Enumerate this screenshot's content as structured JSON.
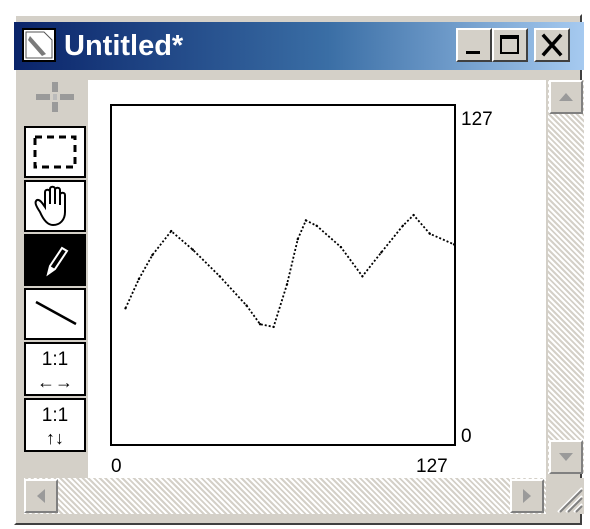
{
  "window": {
    "title": "Untitled*",
    "buttons": {
      "minimize": "minimize",
      "maximize": "maximize",
      "close": "close"
    }
  },
  "toolbar": {
    "tools": [
      {
        "name": "move",
        "icon": "move-cross-icon"
      },
      {
        "name": "marquee-select",
        "icon": "dashed-rectangle-icon"
      },
      {
        "name": "hand",
        "icon": "hand-icon"
      },
      {
        "name": "pencil",
        "icon": "pencil-icon",
        "selected": true
      },
      {
        "name": "line",
        "icon": "line-icon"
      }
    ],
    "zoom_horizontal": {
      "ratio": "1:1",
      "arrows": "←→"
    },
    "zoom_vertical": {
      "ratio": "1:1",
      "arrows": "↑↓"
    }
  },
  "graph": {
    "y_max_label": "127",
    "y_min_label": "0",
    "x_min_label": "0",
    "x_max_label": "127"
  },
  "chart_data": {
    "type": "line",
    "xlim": [
      0,
      127
    ],
    "ylim": [
      0,
      127
    ],
    "points": [
      [
        5,
        51
      ],
      [
        10,
        62
      ],
      [
        15,
        71
      ],
      [
        22,
        80
      ],
      [
        30,
        73
      ],
      [
        40,
        63
      ],
      [
        50,
        52
      ],
      [
        55,
        45
      ],
      [
        60,
        44
      ],
      [
        65,
        60
      ],
      [
        69,
        77
      ],
      [
        72,
        84
      ],
      [
        76,
        82
      ],
      [
        85,
        74
      ],
      [
        93,
        63
      ],
      [
        100,
        72
      ],
      [
        108,
        82
      ],
      [
        112,
        86
      ],
      [
        118,
        79
      ],
      [
        127,
        75
      ]
    ],
    "grid": false
  },
  "colors": {
    "titlebar_start": "#0a246a",
    "titlebar_end": "#a6caf0",
    "chrome": "#d4d0c8"
  }
}
